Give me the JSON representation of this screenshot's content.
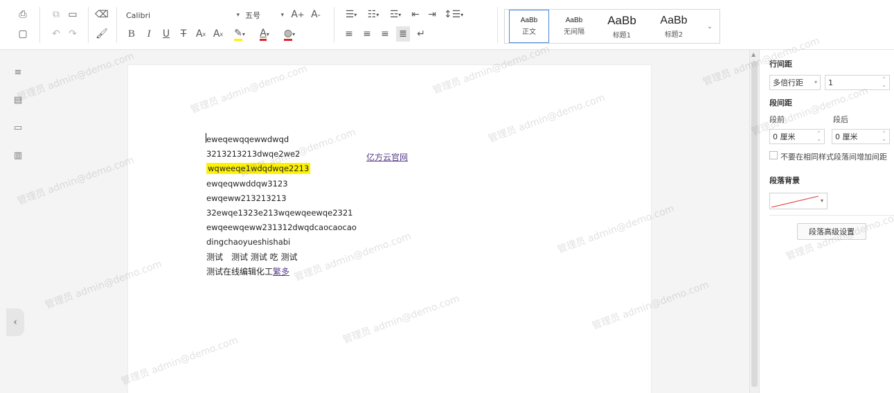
{
  "toolbar": {
    "font_name": "Calibri",
    "font_size": "五号",
    "grow_font": "A",
    "shrink_font": "A",
    "bold": "B",
    "italic": "I",
    "underline": "U",
    "strike": "T",
    "superscript": "A",
    "subscript": "A",
    "font_color_letter": "A",
    "styles": [
      {
        "sample": "AaBb",
        "name": "正文"
      },
      {
        "sample": "AaBb",
        "name": "无间隔"
      },
      {
        "sample": "AaBb",
        "name": "标题1"
      },
      {
        "sample": "AaBb",
        "name": "标题2"
      }
    ],
    "active_style_color": "#4a88d8"
  },
  "left_rail": {
    "collapse_glyph": "‹"
  },
  "document": {
    "lines": [
      {
        "text": "eweqewqqewwdwqd"
      },
      {
        "text": "3213213213dwqe2we2"
      },
      {
        "text": "wqweeqe1wdqdwqe2213",
        "highlight": true
      },
      {
        "text": "ewqeqwwddqw3123"
      },
      {
        "text": "ewqeww213213213"
      },
      {
        "text": "32ewqe1323e213wqewqeewqe2321"
      },
      {
        "text": "ewqeewqeww231312dwqdcaocaocao"
      },
      {
        "text": "dingchaoyueshishabi"
      },
      {
        "text": "测试　测试 测试 吃 测试"
      },
      {
        "text": "测试在线编辑化工",
        "link": "繁多"
      }
    ],
    "right_link": "亿方云官网",
    "highlight_color": "#fff200",
    "link_color": "#5a3e8a"
  },
  "right_panel": {
    "line_spacing_title": "行间距",
    "line_spacing_mode": "多倍行距",
    "line_spacing_value": "1",
    "paragraph_spacing_title": "段间距",
    "before_label": "段前",
    "after_label": "段后",
    "before_value": "0 厘米",
    "after_value": "0 厘米",
    "no_space_same_style": "不要在相同样式段落间增加间距",
    "paragraph_bg_title": "段落背景",
    "advanced_button": "段落高级设置"
  },
  "watermark": "管理员 admin@demo.com"
}
